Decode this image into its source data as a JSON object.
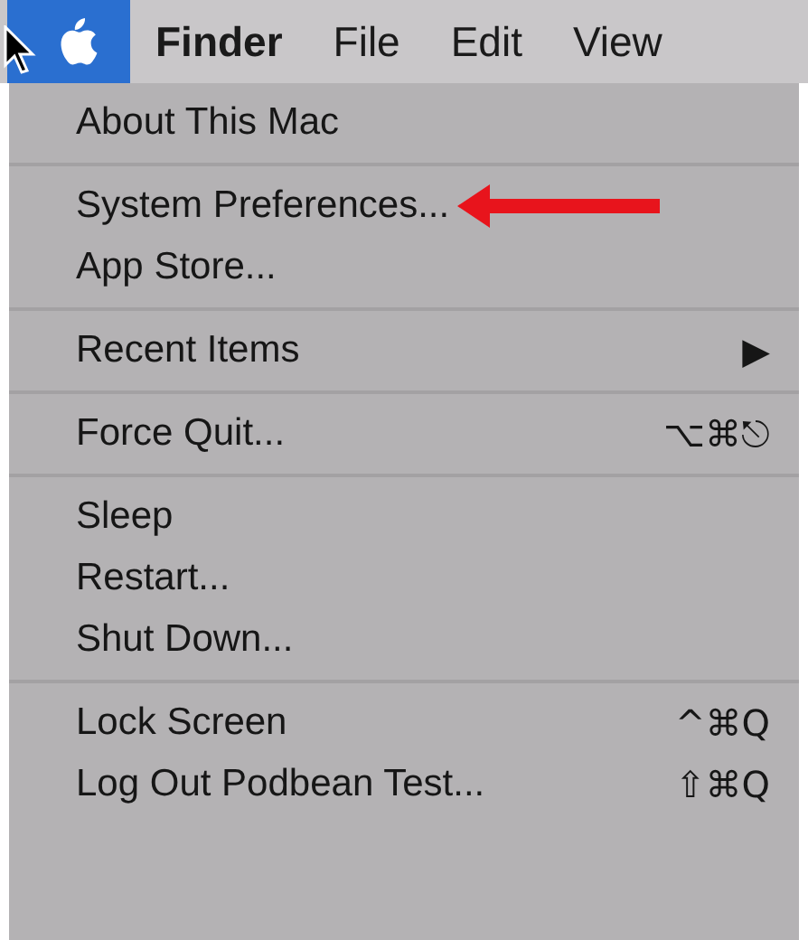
{
  "menu_bar": [
    {
      "kind": "logo",
      "selected": true
    },
    {
      "kind": "app",
      "label": "Finder",
      "selected": false
    },
    {
      "kind": "menu",
      "label": "File",
      "selected": false
    },
    {
      "kind": "menu",
      "label": "Edit",
      "selected": false
    },
    {
      "kind": "menu",
      "label": "View",
      "selected": false
    }
  ],
  "menu_sections": [
    [
      {
        "label": "About This Mac"
      }
    ],
    [
      {
        "label": "System Preferences...",
        "pointed_at": true
      },
      {
        "label": "App Store..."
      }
    ],
    [
      {
        "label": "Recent Items",
        "shortcut": "▶"
      }
    ],
    [
      {
        "label": "Force Quit...",
        "shortcut": "⌥⌘⎋"
      }
    ],
    [
      {
        "label": "Sleep"
      },
      {
        "label": "Restart..."
      },
      {
        "label": "Shut Down..."
      }
    ],
    [
      {
        "label": "Lock Screen",
        "shortcut": "^⌘Q"
      },
      {
        "label": "Log Out Podbean Test...",
        "shortcut": "⇧⌘Q"
      }
    ]
  ]
}
